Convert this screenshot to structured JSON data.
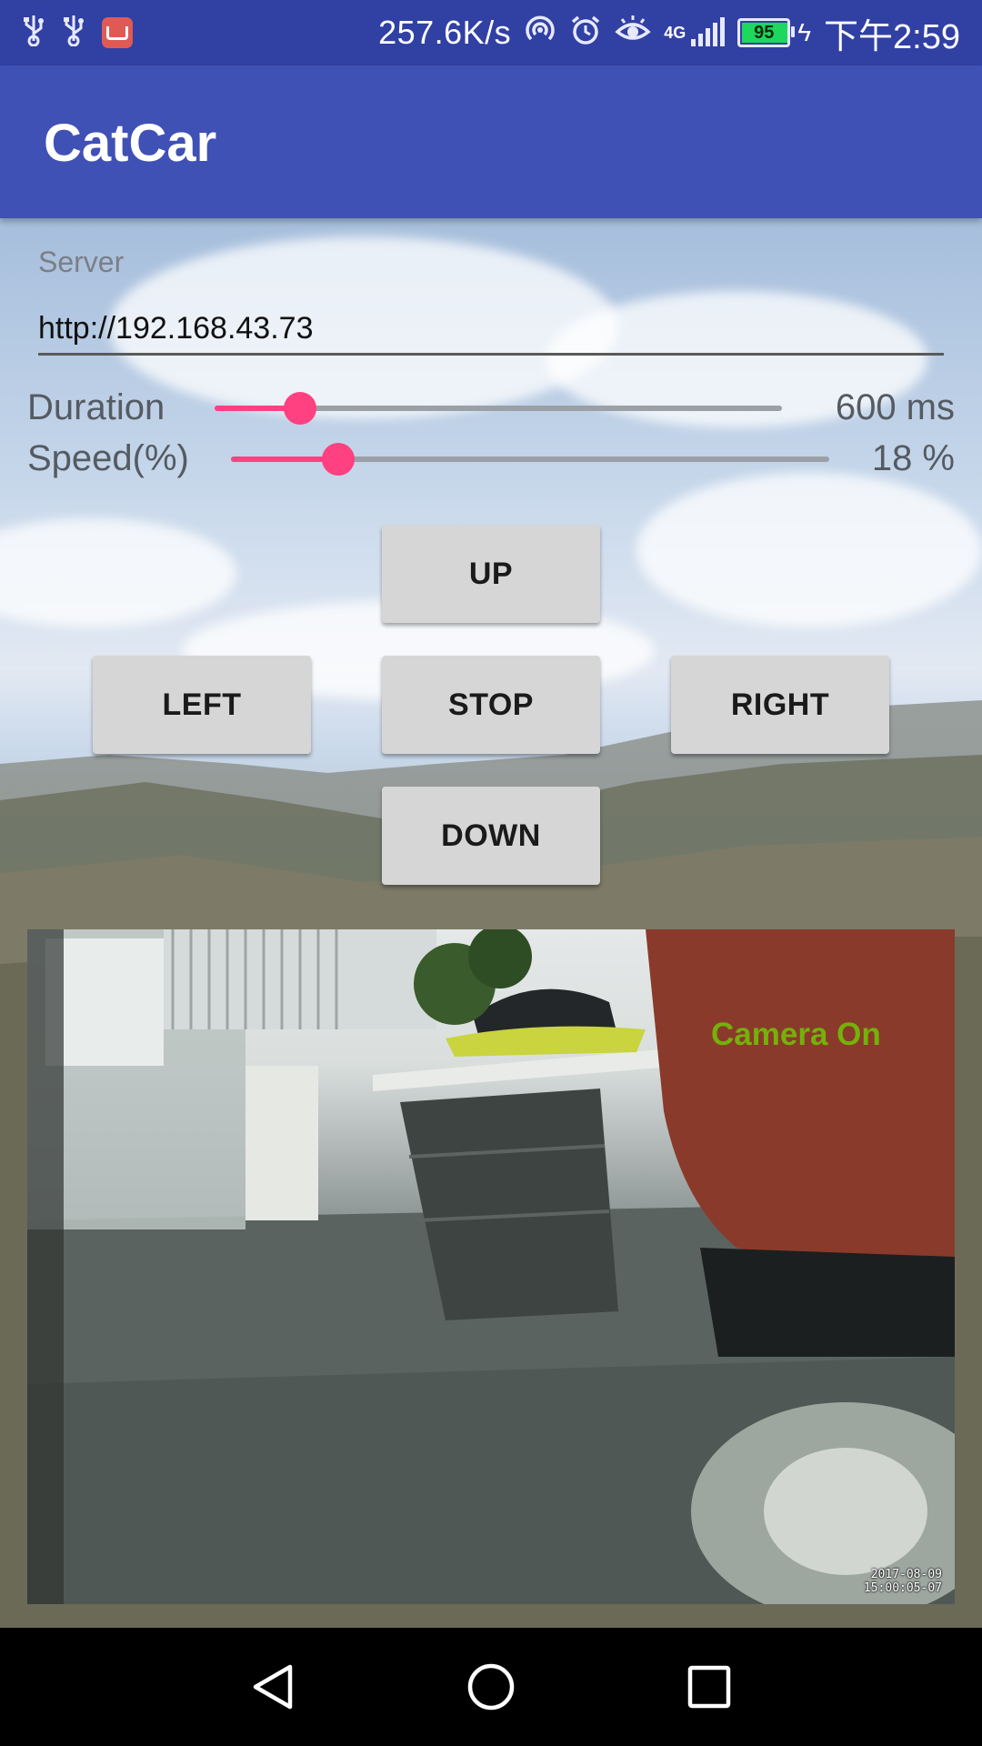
{
  "status_bar": {
    "net_speed": "257.6K/s",
    "network_type": "4G",
    "battery_level": "95",
    "battery_fraction": 0.95,
    "time": "下午2:59",
    "icons": [
      "usb-icon",
      "usb-icon",
      "app-notification-icon",
      "hotspot-icon",
      "alarm-icon",
      "eye-comfort-icon",
      "signal-icon",
      "battery-icon",
      "charging-icon"
    ]
  },
  "app_bar": {
    "title": "CatCar"
  },
  "server": {
    "label": "Server",
    "value": "http://192.168.43.73"
  },
  "duration": {
    "label": "Duration",
    "value_text": "600 ms",
    "fraction": 0.15
  },
  "speed": {
    "label": "Speed(%)",
    "value_text": "18 %",
    "fraction": 0.18
  },
  "controls": {
    "up": "UP",
    "left": "LEFT",
    "stop": "STOP",
    "right": "RIGHT",
    "down": "DOWN"
  },
  "camera": {
    "status": "Camera On",
    "timestamp_date": "2017-08-09",
    "timestamp_time": "15:00:05-07"
  },
  "colors": {
    "status_bar": "#3140a3",
    "primary": "#3f51b5",
    "accent": "#ff4081",
    "camera_status": "#74b10a",
    "button": "#d6d6d6"
  },
  "nav_bar": {
    "icons": [
      "back-icon",
      "home-icon",
      "recents-icon"
    ]
  }
}
